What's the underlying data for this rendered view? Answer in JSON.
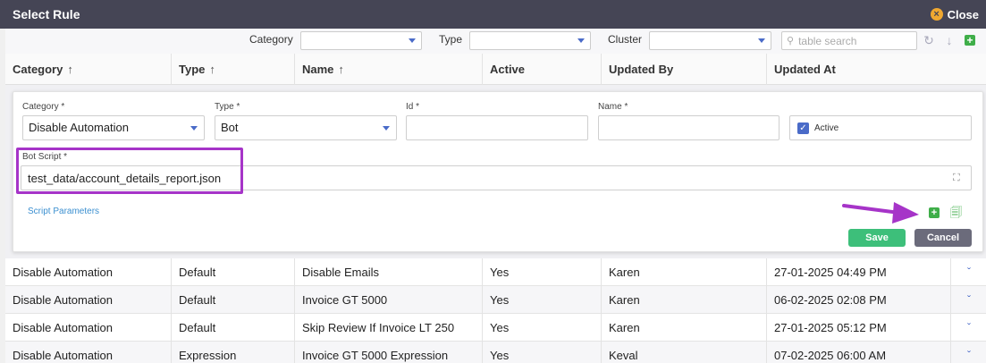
{
  "window": {
    "title": "Select Rule",
    "close_label": "Close"
  },
  "filters": {
    "category_label": "Category",
    "type_label": "Type",
    "cluster_label": "Cluster",
    "search_placeholder": "table search"
  },
  "columns": [
    "Category",
    "Type",
    "Name",
    "Active",
    "Updated By",
    "Updated At"
  ],
  "form": {
    "category_label": "Category *",
    "category_value": "Disable Automation",
    "type_label": "Type *",
    "type_value": "Bot",
    "id_label": "Id *",
    "id_value": "",
    "name_label": "Name *",
    "name_value": "",
    "active_label": "Active",
    "bot_script_label": "Bot Script *",
    "bot_script_value": "test_data/account_details_report.json",
    "script_params_label": "Script Parameters",
    "save_label": "Save",
    "cancel_label": "Cancel"
  },
  "rows": [
    {
      "category": "Disable Automation",
      "type": "Default",
      "name": "Disable Emails",
      "active": "Yes",
      "updated_by": "Karen",
      "updated_at": "27-01-2025 04:49 PM"
    },
    {
      "category": "Disable Automation",
      "type": "Default",
      "name": "Invoice GT 5000",
      "active": "Yes",
      "updated_by": "Karen",
      "updated_at": "06-02-2025 02:08 PM"
    },
    {
      "category": "Disable Automation",
      "type": "Default",
      "name": "Skip Review If Invoice LT 250",
      "active": "Yes",
      "updated_by": "Karen",
      "updated_at": "27-01-2025 05:12 PM"
    },
    {
      "category": "Disable Automation",
      "type": "Expression",
      "name": "Invoice GT 5000 Expression",
      "active": "Yes",
      "updated_by": "Keval",
      "updated_at": "07-02-2025 06:00 AM"
    }
  ],
  "colors": {
    "titlebar": "#454555",
    "accent": "#4a6bc8",
    "save": "#3dbf7a",
    "cancel": "#6b6b7b",
    "highlight": "#a634c8"
  }
}
